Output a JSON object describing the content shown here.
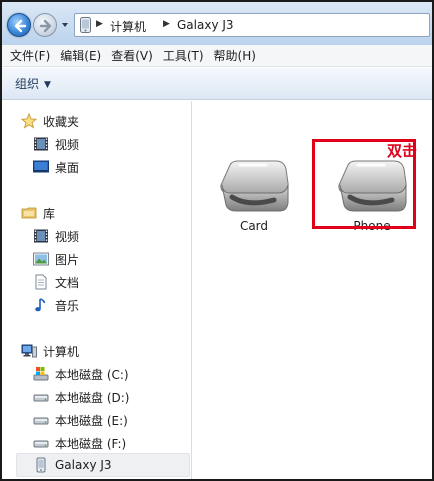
{
  "address": {
    "breadcrumbs": [
      "计算机",
      "Galaxy J3"
    ]
  },
  "menu": {
    "items": [
      "文件(F)",
      "编辑(E)",
      "查看(V)",
      "工具(T)",
      "帮助(H)"
    ]
  },
  "command_bar": {
    "organize_label": "组织"
  },
  "navigation": {
    "favorites": {
      "label": "收藏夹",
      "items": [
        "视频",
        "桌面"
      ]
    },
    "libraries": {
      "label": "库",
      "items": [
        "视频",
        "图片",
        "文档",
        "音乐"
      ]
    },
    "computer": {
      "label": "计算机",
      "items": [
        "本地磁盘 (C:)",
        "本地磁盘 (D:)",
        "本地磁盘 (E:)",
        "本地磁盘 (F:)",
        "Galaxy J3"
      ]
    }
  },
  "content": {
    "drives": [
      "Card",
      "Phone"
    ],
    "annotation": "双击"
  },
  "colors": {
    "highlight": "#e0001a",
    "address_bar": "#c9dcf1"
  }
}
